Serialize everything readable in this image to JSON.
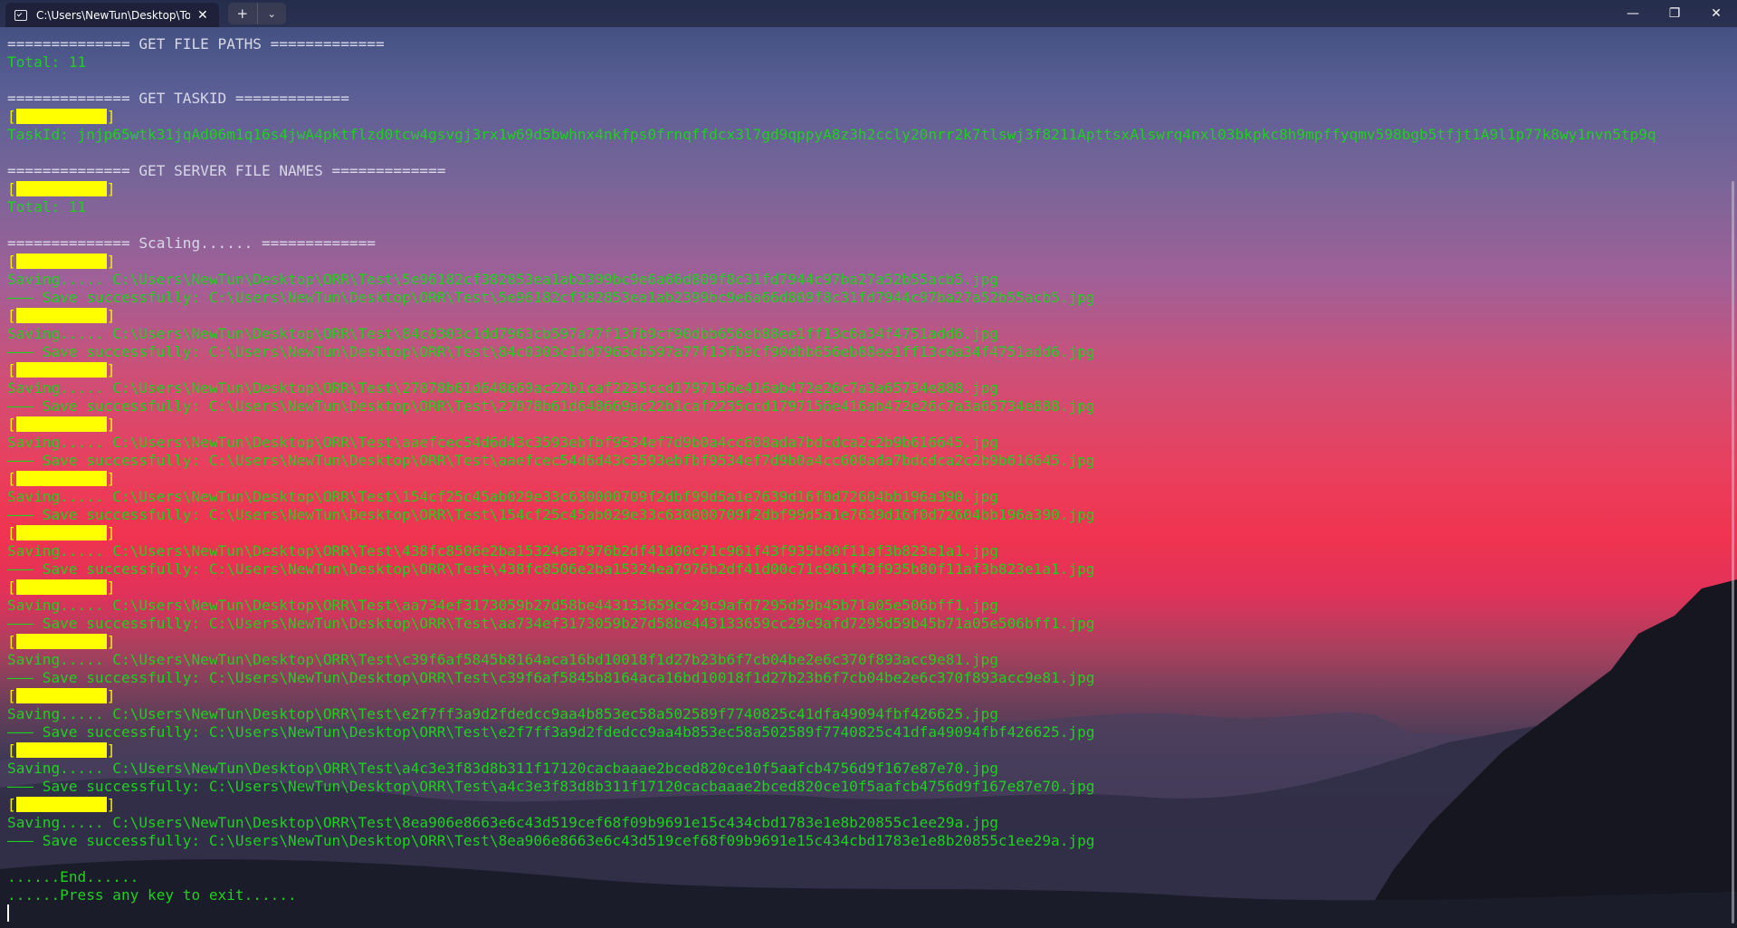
{
  "window": {
    "tab_title": "C:\\Users\\NewTun\\Desktop\\To",
    "tab_close": "✕",
    "new_tab": "+",
    "dropdown": "⌄",
    "minimize": "—",
    "maximize": "❐",
    "close": "✕"
  },
  "terminal": {
    "lines": [
      {
        "type": "header",
        "text": "============== GET FILE PATHS ============="
      },
      {
        "type": "plain",
        "text": "Total: 11"
      },
      {
        "type": "blank",
        "text": ""
      },
      {
        "type": "header",
        "text": "============== GET TASKID ============="
      },
      {
        "type": "redacted",
        "text": ""
      },
      {
        "type": "plain",
        "text": "TaskId: jnjp65wtk31jqAd06m1q16s4jwA4pktflzd0tcw4gsvgj3rx1w69d5bwhnx4nkfps0frnqffdcx3l7gd9qppyA8z3h2ccly20nrr2k7tlswj3f8211ApttsxAlswrq4nxl03bkpkc8h9mpffyqmv598bgb5tfjt1A9l1p77k8wy1nvn5tp9q"
      },
      {
        "type": "blank",
        "text": ""
      },
      {
        "type": "header",
        "text": "============== GET SERVER FILE NAMES ============="
      },
      {
        "type": "redacted",
        "text": ""
      },
      {
        "type": "plain",
        "text": "Total: 11"
      },
      {
        "type": "blank",
        "text": ""
      },
      {
        "type": "header",
        "text": "============== Scaling...... ============="
      },
      {
        "type": "redacted",
        "text": ""
      },
      {
        "type": "plain",
        "text": "Saving..... C:\\Users\\NewTun\\Desktop\\ORR\\Test\\5e96182cf382853ea1ab2399bc9e6a66d809f8c31fd7944c97ba27a52b55acb5.jpg"
      },
      {
        "type": "plain",
        "text": "——— Save successfully: C:\\Users\\NewTun\\Desktop\\ORR\\Test\\5e96182cf382853ea1ab2399bc9e6a66d809f8c31fd7944c97ba27a52b55acb5.jpg"
      },
      {
        "type": "redacted",
        "text": ""
      },
      {
        "type": "plain",
        "text": "Saving..... C:\\Users\\NewTun\\Desktop\\ORR\\Test\\84c0303c1dd7963cb597a77f13fb9cf90dbb656eb88ee1ff13c6a34f4751add6.jpg"
      },
      {
        "type": "plain",
        "text": "——— Save successfully: C:\\Users\\NewTun\\Desktop\\ORR\\Test\\84c0303c1dd7963cb597a77f13fb9cf90dbb656eb88ee1ff13c6a34f4751add6.jpg"
      },
      {
        "type": "redacted",
        "text": ""
      },
      {
        "type": "plain",
        "text": "Saving..... C:\\Users\\NewTun\\Desktop\\ORR\\Test\\27078b61d648669ac22b1caf2235ccd1797156e416ab472e26c7a3a65734e888.jpg"
      },
      {
        "type": "plain",
        "text": "——— Save successfully: C:\\Users\\NewTun\\Desktop\\ORR\\Test\\27078b61d648669ac22b1caf2235ccd1797156e416ab472e26c7a3a65734e888.jpg"
      },
      {
        "type": "redacted",
        "text": ""
      },
      {
        "type": "plain",
        "text": "Saving..... C:\\Users\\NewTun\\Desktop\\ORR\\Test\\aaefcec54d6d43c3593ebfbf9534ef7d9b0a4cc608ada7bdcdca2c2b9b616645.jpg"
      },
      {
        "type": "plain",
        "text": "——— Save successfully: C:\\Users\\NewTun\\Desktop\\ORR\\Test\\aaefcec54d6d43c3593ebfbf9534ef7d9b0a4cc608ada7bdcdca2c2b9b616645.jpg"
      },
      {
        "type": "redacted",
        "text": ""
      },
      {
        "type": "plain",
        "text": "Saving..... C:\\Users\\NewTun\\Desktop\\ORR\\Test\\154cf25c45ab029e33c630000709f2dbf99d5a1e7639d16f0d72604bb196a390.jpg"
      },
      {
        "type": "plain",
        "text": "——— Save successfully: C:\\Users\\NewTun\\Desktop\\ORR\\Test\\154cf25c45ab029e33c630000709f2dbf99d5a1e7639d16f0d72604bb196a390.jpg"
      },
      {
        "type": "redacted",
        "text": ""
      },
      {
        "type": "plain",
        "text": "Saving..... C:\\Users\\NewTun\\Desktop\\ORR\\Test\\438fc8506e2ba15324ea7976b2df41d00c71c961f43f935b80f11af3b823e1a1.jpg"
      },
      {
        "type": "plain",
        "text": "——— Save successfully: C:\\Users\\NewTun\\Desktop\\ORR\\Test\\438fc8506e2ba15324ea7976b2df41d00c71c961f43f935b80f11af3b823e1a1.jpg"
      },
      {
        "type": "redacted",
        "text": ""
      },
      {
        "type": "plain",
        "text": "Saving..... C:\\Users\\NewTun\\Desktop\\ORR\\Test\\aa734ef3173059b27d58be443133659cc29c9afd7295d59b45b71a05e506bff1.jpg"
      },
      {
        "type": "plain",
        "text": "——— Save successfully: C:\\Users\\NewTun\\Desktop\\ORR\\Test\\aa734ef3173059b27d58be443133659cc29c9afd7295d59b45b71a05e506bff1.jpg"
      },
      {
        "type": "redacted",
        "text": ""
      },
      {
        "type": "plain",
        "text": "Saving..... C:\\Users\\NewTun\\Desktop\\ORR\\Test\\c39f6af5845b8164aca16bd10018f1d27b23b6f7cb04be2e6c370f893acc9e81.jpg"
      },
      {
        "type": "plain",
        "text": "——— Save successfully: C:\\Users\\NewTun\\Desktop\\ORR\\Test\\c39f6af5845b8164aca16bd10018f1d27b23b6f7cb04be2e6c370f893acc9e81.jpg"
      },
      {
        "type": "redacted",
        "text": ""
      },
      {
        "type": "plain",
        "text": "Saving..... C:\\Users\\NewTun\\Desktop\\ORR\\Test\\e2f7ff3a9d2fdedcc9aa4b853ec58a502589f7740825c41dfa49094fbf426625.jpg"
      },
      {
        "type": "plain",
        "text": "——— Save successfully: C:\\Users\\NewTun\\Desktop\\ORR\\Test\\e2f7ff3a9d2fdedcc9aa4b853ec58a502589f7740825c41dfa49094fbf426625.jpg"
      },
      {
        "type": "redacted",
        "text": ""
      },
      {
        "type": "plain",
        "text": "Saving..... C:\\Users\\NewTun\\Desktop\\ORR\\Test\\a4c3e3f83d8b311f17120cacbaaae2bced820ce10f5aafcb4756d9f167e87e70.jpg"
      },
      {
        "type": "plain",
        "text": "——— Save successfully: C:\\Users\\NewTun\\Desktop\\ORR\\Test\\a4c3e3f83d8b311f17120cacbaaae2bced820ce10f5aafcb4756d9f167e87e70.jpg"
      },
      {
        "type": "redacted",
        "text": ""
      },
      {
        "type": "plain",
        "text": "Saving..... C:\\Users\\NewTun\\Desktop\\ORR\\Test\\8ea906e8663e6c43d519cef68f09b9691e15c434cbd1783e1e8b20855c1ee29a.jpg"
      },
      {
        "type": "plain",
        "text": "——— Save successfully: C:\\Users\\NewTun\\Desktop\\ORR\\Test\\8ea906e8663e6c43d519cef68f09b9691e15c434cbd1783e1e8b20855c1ee29a.jpg"
      },
      {
        "type": "blank",
        "text": ""
      },
      {
        "type": "plain",
        "text": "......End......"
      },
      {
        "type": "plain",
        "text": "......Press any key to exit......"
      },
      {
        "type": "cursor",
        "text": ""
      }
    ]
  },
  "colors": {
    "terminal_green": "#1fd01f",
    "header_text": "#d8d8e8",
    "redaction": "#ffff00"
  }
}
